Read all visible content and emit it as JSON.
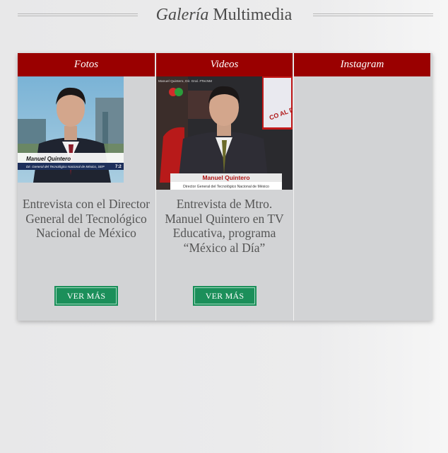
{
  "header": {
    "title_italic": "Galería",
    "title_rest": "Multimedia"
  },
  "columns": [
    {
      "heading": "Fotos",
      "image": {
        "lower_third_name": "Manuel Quintero",
        "lower_third_title": "Dir. General del Tecnológico Nacional de México, SEP",
        "corner_time": "7:2"
      },
      "caption": "Entrevista con el Director General del Tecnológico Nacional de México",
      "button": "VER MÁS"
    },
    {
      "heading": "Videos",
      "image": {
        "lower_third_name": "Manuel Quintero",
        "lower_third_title": "Director General del Tecnológico Nacional de México",
        "top_text": "Manuel Quintero, Dir. Gral. #TecNM",
        "banner": "CO AL DÍ"
      },
      "caption": "Entrevista de Mtro. Manuel Quintero en TV Educativa, programa “México al Día”",
      "button": "VER MÁS"
    },
    {
      "heading": "Instagram"
    }
  ],
  "colors": {
    "header_red": "#9a0000",
    "button_green": "#1b8f5a",
    "panel_gray": "#d2d3d5"
  }
}
